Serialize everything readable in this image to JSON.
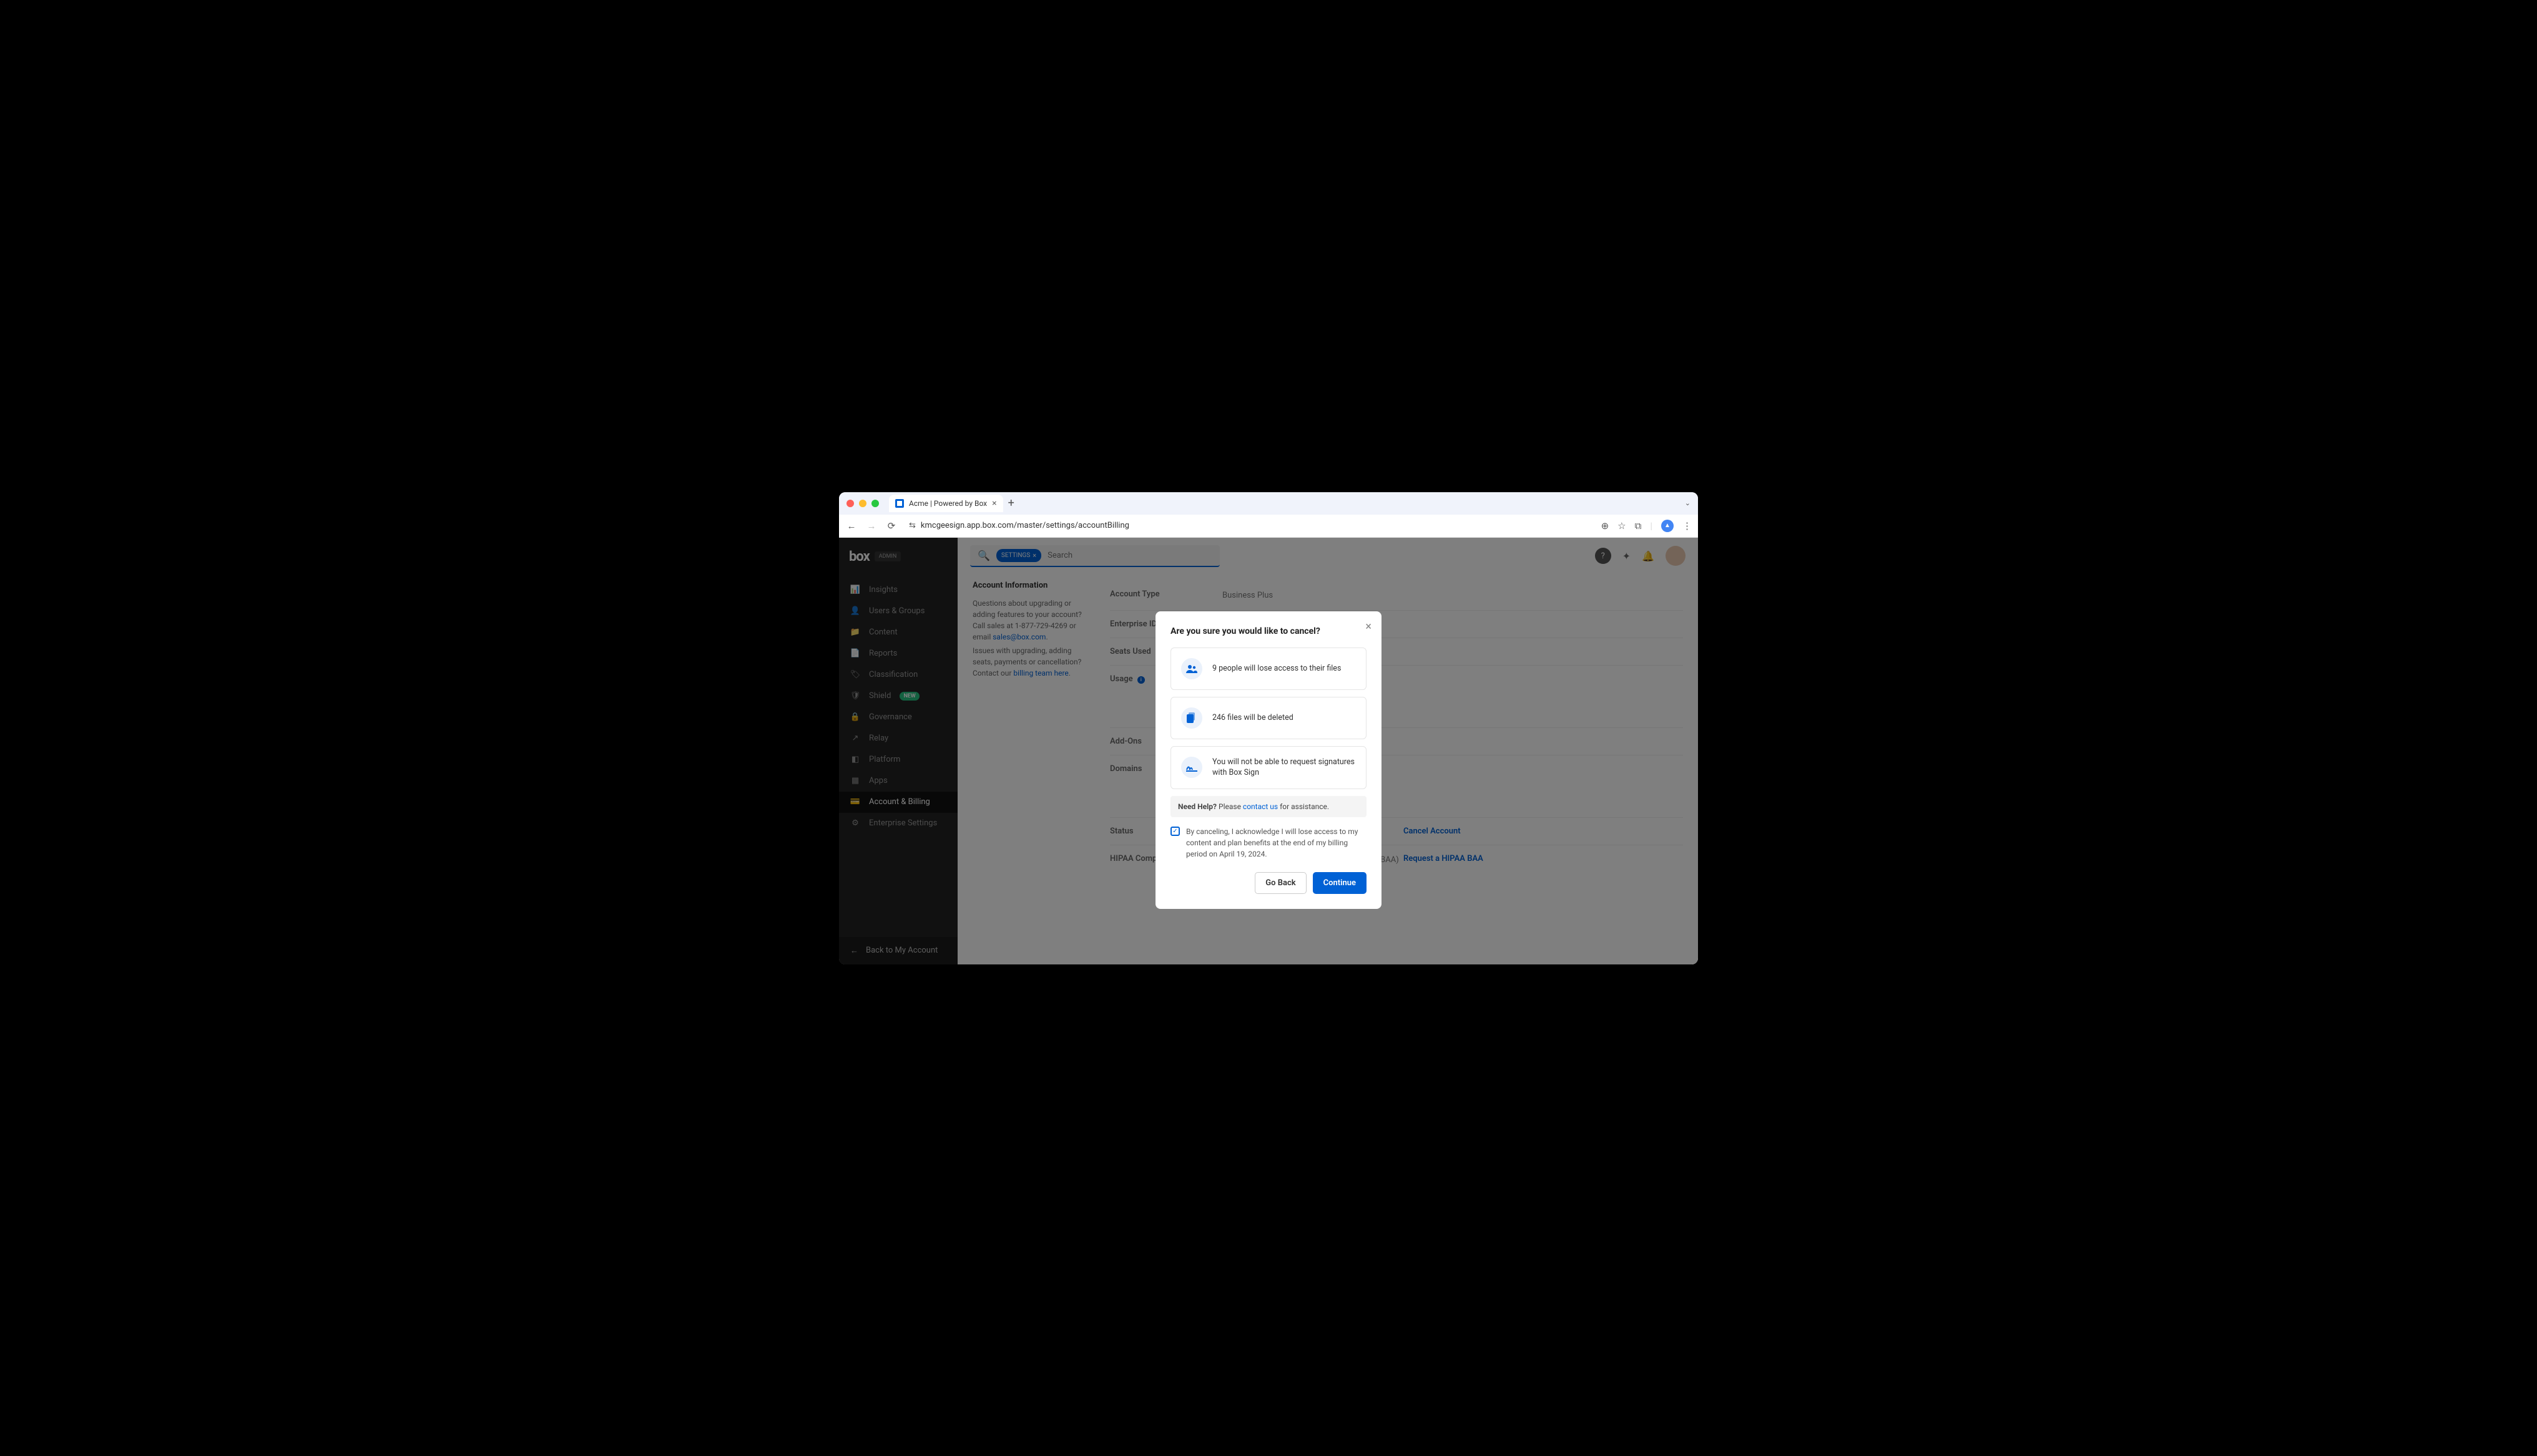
{
  "browser": {
    "tab_title": "Acme | Powered by Box",
    "url": "kmcgeesign.app.box.com/master/settings/accountBilling"
  },
  "sidebar": {
    "logo": "box",
    "admin_badge": "ADMIN",
    "items": [
      {
        "label": "Insights",
        "icon": "bar-chart"
      },
      {
        "label": "Users & Groups",
        "icon": "user"
      },
      {
        "label": "Content",
        "icon": "folder"
      },
      {
        "label": "Reports",
        "icon": "file"
      },
      {
        "label": "Classification",
        "icon": "tag"
      },
      {
        "label": "Shield",
        "icon": "shield",
        "badge": "NEW"
      },
      {
        "label": "Governance",
        "icon": "lock"
      },
      {
        "label": "Relay",
        "icon": "arrow"
      },
      {
        "label": "Platform",
        "icon": "cube"
      },
      {
        "label": "Apps",
        "icon": "grid"
      },
      {
        "label": "Account & Billing",
        "icon": "card",
        "active": true
      },
      {
        "label": "Enterprise Settings",
        "icon": "gear"
      }
    ],
    "back_link": "Back to My Account"
  },
  "search": {
    "chip": "SETTINGS",
    "placeholder": "Search"
  },
  "account_info": {
    "heading": "Account Information",
    "desc1": "Questions about upgrading or adding features to your account? Call sales at 1-877-729-4269 or email ",
    "email_link": "sales@box.com",
    "desc2": "Issues with upgrading, adding seats, payments or cancellation? Contact our ",
    "billing_link": "billing team here"
  },
  "fields": {
    "account_type": {
      "label": "Account Type",
      "value": "Business Plus"
    },
    "enterprise_id": {
      "label": "Enterprise ID",
      "value": ""
    },
    "seats_used": {
      "label": "Seats Used",
      "value": ""
    },
    "usage": {
      "label": "Usage",
      "value": ""
    },
    "addons": {
      "label": "Add-Ons",
      "value": ""
    },
    "domains": {
      "label": "Domains",
      "value": ""
    },
    "status": {
      "label": "Status",
      "action": "Cancel Account"
    },
    "hipaa": {
      "label": "HIPAA Compliance",
      "value": "The HIPAA Business Associate Agreement (BAA) is a document we may sign with you acknowledging storage of Personal Health Information (PHI) in Box.",
      "action": "Request a HIPAA BAA"
    }
  },
  "modal": {
    "title": "Are you sure you would like to cancel?",
    "warn1": "9 people will lose access to their files",
    "warn2": "246 files will be deleted",
    "warn3": "You will not be able to request signatures with Box Sign",
    "help_bold": "Need Help?",
    "help_text": " Please ",
    "help_link": "contact us",
    "help_text2": " for assistance.",
    "ack": "By canceling, I acknowledge I will lose access to my content and plan benefits at the end of my billing period on April 19, 2024.",
    "go_back": "Go Back",
    "continue": "Continue"
  }
}
